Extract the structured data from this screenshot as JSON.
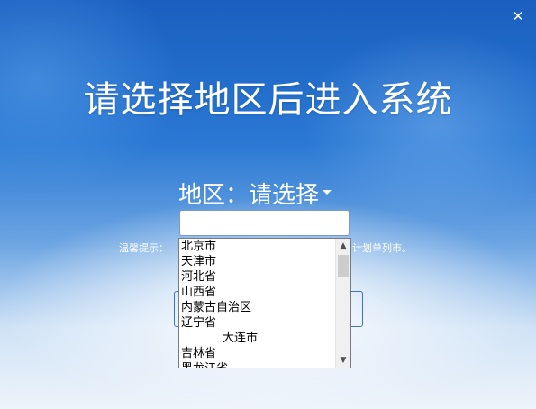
{
  "window": {
    "close_glyph": "✕"
  },
  "title": "请选择地区后进入系统",
  "region": {
    "label": "地区：",
    "select_text": "请选择",
    "input_value": ""
  },
  "tip": {
    "prefix": "温馨提示：",
    "suffix": "计划单列市。"
  },
  "dropdown": {
    "options": [
      {
        "label": "北京市",
        "sub": false
      },
      {
        "label": "天津市",
        "sub": false
      },
      {
        "label": "河北省",
        "sub": false
      },
      {
        "label": "山西省",
        "sub": false
      },
      {
        "label": "内蒙古自治区",
        "sub": false
      },
      {
        "label": "辽宁省",
        "sub": false
      },
      {
        "label": "大连市",
        "sub": true
      },
      {
        "label": "吉林省",
        "sub": false
      },
      {
        "label": "黑龙江省",
        "sub": false
      }
    ],
    "scroll_up_glyph": "▲",
    "scroll_down_glyph": "▼"
  }
}
